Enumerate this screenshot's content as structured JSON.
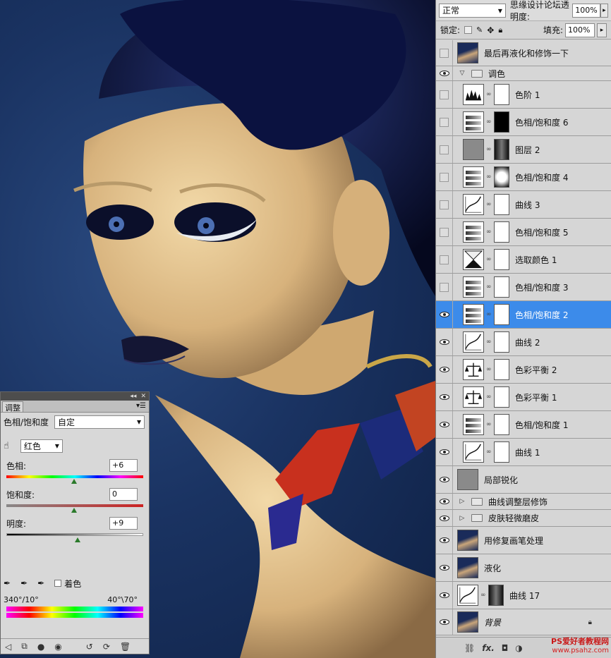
{
  "layers_panel": {
    "blend_mode": "正常",
    "opacity_label": "思缘设计论坛透明度:",
    "opacity_value": "100%",
    "lock_label": "锁定:",
    "fill_label": "填充:",
    "fill_value": "100%",
    "layers": [
      {
        "name": "最后再液化和修饰一下",
        "visible": false,
        "kind": "image"
      },
      {
        "name": "调色",
        "visible": true,
        "kind": "group-open"
      },
      {
        "name": "色阶 1",
        "visible": false,
        "kind": "levels"
      },
      {
        "name": "色相/饱和度 6",
        "visible": false,
        "kind": "hue"
      },
      {
        "name": "图层 2",
        "visible": false,
        "kind": "gray"
      },
      {
        "name": "色相/饱和度 4",
        "visible": false,
        "kind": "hue"
      },
      {
        "name": "曲线 3",
        "visible": false,
        "kind": "curves"
      },
      {
        "name": "色相/饱和度 5",
        "visible": false,
        "kind": "hue"
      },
      {
        "name": "选取颜色 1",
        "visible": false,
        "kind": "selective"
      },
      {
        "name": "色相/饱和度 3",
        "visible": false,
        "kind": "hue"
      },
      {
        "name": "色相/饱和度 2",
        "visible": true,
        "kind": "hue",
        "selected": true
      },
      {
        "name": "曲线 2",
        "visible": true,
        "kind": "curves"
      },
      {
        "name": "色彩平衡 2",
        "visible": true,
        "kind": "balance"
      },
      {
        "name": "色彩平衡 1",
        "visible": true,
        "kind": "balance"
      },
      {
        "name": "色相/饱和度 1",
        "visible": true,
        "kind": "hue"
      },
      {
        "name": "曲线 1",
        "visible": true,
        "kind": "curves"
      },
      {
        "name": "局部锐化",
        "visible": true,
        "kind": "gray-single"
      },
      {
        "name": "曲线调整层修饰",
        "visible": true,
        "kind": "group-closed"
      },
      {
        "name": "皮肤轻微磨皮",
        "visible": true,
        "kind": "group-closed"
      },
      {
        "name": "用修复画笔处理",
        "visible": true,
        "kind": "image"
      },
      {
        "name": "液化",
        "visible": true,
        "kind": "image"
      },
      {
        "name": "曲线 17",
        "visible": true,
        "kind": "curves-mask"
      },
      {
        "name": "背景",
        "visible": true,
        "kind": "background"
      }
    ],
    "footer_fx": "fx."
  },
  "adjustments": {
    "tab": "调整",
    "title": "色相/饱和度",
    "preset": "自定",
    "channel": "红色",
    "hue_label": "色相:",
    "hue_value": "+6",
    "sat_label": "饱和度:",
    "sat_value": "0",
    "light_label": "明度:",
    "light_value": "+9",
    "colorize_label": "着色",
    "range_left": "340°/10°",
    "range_right": "40°\\70°",
    "hue_level": 0.5,
    "sat_level": 0.5,
    "light_level": 0.52
  },
  "watermark": {
    "line1": "PS爱好者教程网",
    "line2": "www.psahz.com"
  }
}
